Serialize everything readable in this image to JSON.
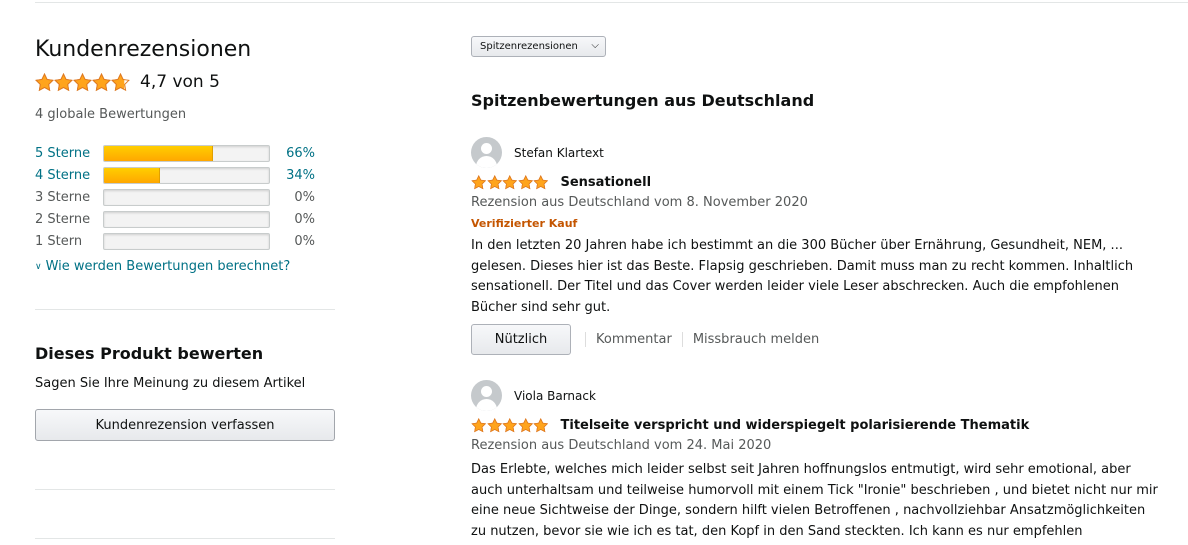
{
  "summary": {
    "title": "Kundenrezensionen",
    "average_rating": 4.7,
    "rating_text": "4,7 von 5",
    "global_ratings": "4 globale Bewertungen",
    "histogram": [
      {
        "label": "5 Sterne",
        "percent": 66,
        "percent_text": "66%",
        "active": true
      },
      {
        "label": "4 Sterne",
        "percent": 34,
        "percent_text": "34%",
        "active": true
      },
      {
        "label": "3 Sterne",
        "percent": 0,
        "percent_text": "0%",
        "active": false
      },
      {
        "label": "2 Sterne",
        "percent": 0,
        "percent_text": "0%",
        "active": false
      },
      {
        "label": "1 Stern",
        "percent": 0,
        "percent_text": "0%",
        "active": false
      }
    ],
    "how_calculated_link": "Wie werden Bewertungen berechnet?"
  },
  "rate_product": {
    "title": "Dieses Produkt bewerten",
    "subtitle": "Sagen Sie Ihre Meinung zu diesem Artikel",
    "button": "Kundenrezension verfassen"
  },
  "sort": {
    "selected": "Spitzenrezensionen"
  },
  "reviews_section": {
    "title": "Spitzenbewertungen aus Deutschland",
    "reviews": [
      {
        "author": "Stefan Klartext",
        "stars": 5,
        "title": "Sensationell",
        "date": "Rezension aus Deutschland vom 8. November 2020",
        "verified": "Verifizierter Kauf",
        "body": "In den letzten 20 Jahren habe ich bestimmt an die 300 Bücher über Ernährung, Gesundheit, NEM, ... gelesen. Dieses hier ist das Beste. Flapsig geschrieben. Damit muss man zu recht kommen. Inhaltlich sensationell. Der Titel und das Cover werden leider viele Leser abschrecken. Auch die empfohlenen Bücher sind sehr gut.",
        "helpful_button": "Nützlich",
        "comment_link": "Kommentar",
        "report_link": "Missbrauch melden"
      },
      {
        "author": "Viola Barnack",
        "stars": 5,
        "title": "Titelseite verspricht und widerspiegelt polarisierende Thematik",
        "date": "Rezension aus Deutschland vom 24. Mai 2020",
        "body": "Das Erlebte, welches mich leider selbst seit Jahren hoffnungslos entmutigt, wird sehr emotional, aber auch unterhaltsam und teilweise humorvoll mit einem Tick \"Ironie\" beschrieben , und bietet nicht nur mir eine neue Sichtweise der Dinge, sondern hilft vielen Betroffenen , nachvollziehbar Ansatzmöglichkeiten zu nutzen, bevor sie wie ich es tat, den Kopf in den Sand steckten. Ich kann es nur empfehlen"
      }
    ]
  },
  "colors": {
    "star": "#ffa41c",
    "link": "#007185",
    "verified": "#c45500"
  }
}
